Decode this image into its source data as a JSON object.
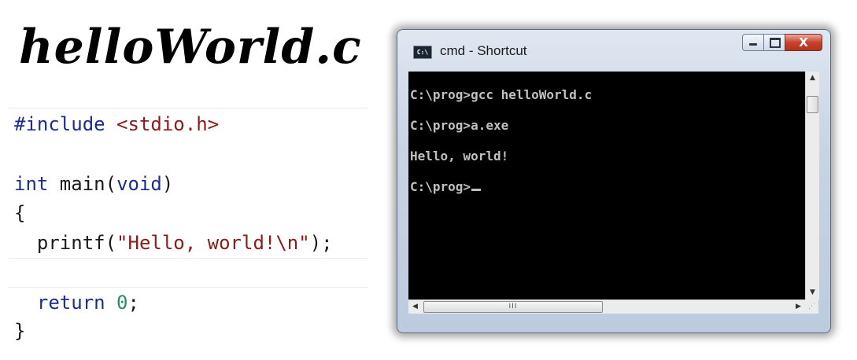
{
  "title": "helloWorld.c",
  "code": {
    "include_directive": "#include",
    "include_header": "<stdio.h>",
    "int_kw": "int",
    "main_name": " main(",
    "void_kw": "void",
    "main_close": ")",
    "open_brace": "{",
    "printf_call": "  printf(",
    "printf_str": "\"Hello, world!\\n\"",
    "printf_end": ");",
    "return_kw": "  return",
    "return_val": "0",
    "return_end": ";",
    "close_brace": "}"
  },
  "window": {
    "title": "cmd - Shortcut",
    "icon_text": "C:\\",
    "minimize_icon": "minimize-icon",
    "maximize_icon": "maximize-icon",
    "close_glyph": "X",
    "hscroll_grip": "III"
  },
  "console": {
    "lines": [
      "C:\\prog>gcc helloWorld.c",
      "C:\\prog>a.exe",
      "Hello, world!",
      "C:\\prog>"
    ]
  },
  "colors": {
    "keyword": "#1d2d8c",
    "string": "#8b1a1a",
    "number": "#2a8a6b",
    "console_bg": "#000000",
    "console_text": "#c0c0c0"
  }
}
